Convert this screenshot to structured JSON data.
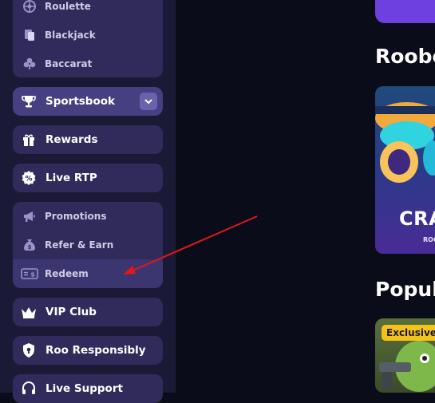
{
  "sidebar": {
    "casino_group": [
      {
        "label": "Roulette",
        "icon": "roulette-icon"
      },
      {
        "label": "Blackjack",
        "icon": "blackjack-icon"
      },
      {
        "label": "Baccarat",
        "icon": "baccarat-icon"
      }
    ],
    "sportsbook": {
      "label": "Sportsbook",
      "icon": "trophy-icon"
    },
    "rewards": {
      "label": "Rewards",
      "icon": "gift-icon"
    },
    "live_rtp": {
      "label": "Live RTP",
      "icon": "percent-icon"
    },
    "promo_group": [
      {
        "label": "Promotions",
        "icon": "megaphone-icon"
      },
      {
        "label": "Refer & Earn",
        "icon": "money-bag-icon"
      },
      {
        "label": "Redeem",
        "icon": "cash-icon"
      }
    ],
    "vip_club": {
      "label": "VIP Club",
      "icon": "crown-icon"
    },
    "roo_responsibly": {
      "label": "Roo Responsibly",
      "icon": "shield-icon"
    },
    "live_support": {
      "label": "Live Support",
      "icon": "headset-icon"
    }
  },
  "main": {
    "section1_title": "Roobe",
    "card1_text": "CRA",
    "card1_sub": "ROO",
    "section2_title": "Popul",
    "card2_badge": "Exclusive"
  },
  "colors": {
    "background": "#0b0c1a",
    "sidebar": "#1b1a36",
    "group": "#302b5a",
    "sportsbook": "#463f80",
    "badge": "#f5c318",
    "annotation_arrow": "#e01818"
  }
}
